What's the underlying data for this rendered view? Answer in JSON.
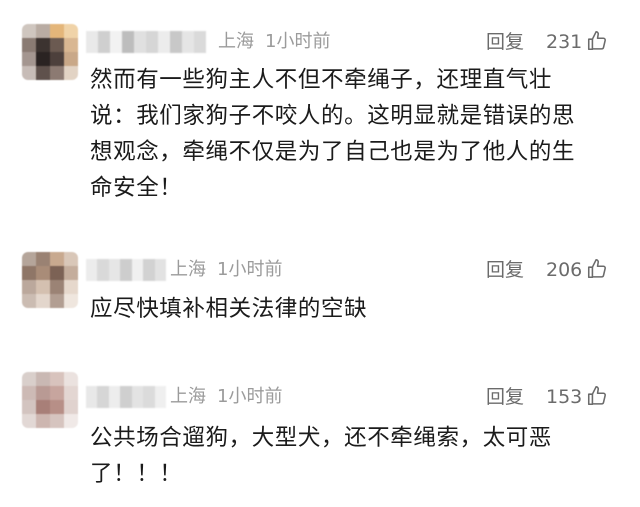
{
  "comments": [
    {
      "location": "上海",
      "time": "1小时前",
      "reply_label": "回复",
      "like_count": "231",
      "like_icon": "thumbs-up-icon",
      "lines": [
        "然而有一些狗主人不但不牵绳子，还理直气壮",
        "说：我们家狗子不咬人的。这明显就是错误的思",
        "想观念，牵绳不仅是为了自己也是为了他人的生",
        "命安全！"
      ]
    },
    {
      "location": "上海",
      "time": "1小时前",
      "reply_label": "回复",
      "like_count": "206",
      "like_icon": "thumbs-up-icon",
      "lines": [
        "应尽快填补相关法律的空缺"
      ]
    },
    {
      "location": "上海",
      "time": "1小时前",
      "reply_label": "回复",
      "like_count": "153",
      "like_icon": "thumbs-up-icon",
      "lines": [
        "公共场合遛狗，大型犬，还不牵绳索，太可恶",
        "了！！！"
      ]
    }
  ],
  "colors": {
    "meta_text": "#9b9b9b",
    "action_text": "#6b6b6b",
    "body_text": "#1b1b1b",
    "background": "#ffffff"
  }
}
